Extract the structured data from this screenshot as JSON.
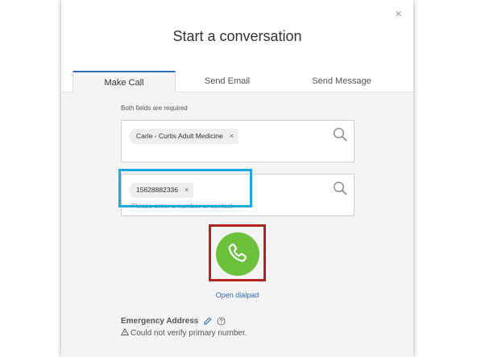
{
  "dialog": {
    "title": "Start a conversation",
    "close_label": "×"
  },
  "tabs": [
    {
      "label": "Make Call",
      "active": true
    },
    {
      "label": "Send Email",
      "active": false
    },
    {
      "label": "Send Message",
      "active": false
    }
  ],
  "form": {
    "required_note": "Both fields are required",
    "contact_chip": "Carle - Curtis Adult Medicine",
    "number_chip": "15628882336",
    "number_placeholder": "Please enter a number or contact",
    "chip_remove": "×"
  },
  "call_button": {
    "icon": "phone-icon",
    "color": "#6cc13b"
  },
  "open_dialpad": "Open dialpad",
  "emergency": {
    "label": "Emergency Address",
    "warning": "Could not verify primary number."
  },
  "annotations": {
    "blue_box_color": "#1ba9e1",
    "red_box_color": "#b5231f"
  }
}
